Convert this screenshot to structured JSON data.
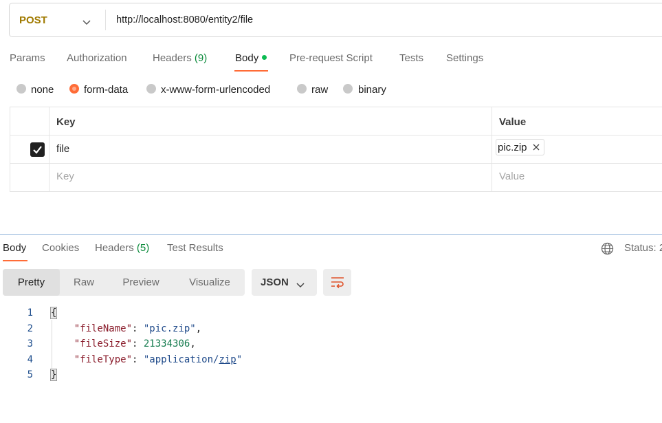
{
  "request": {
    "method": "POST",
    "url": "http://localhost:8080/entity2/file"
  },
  "request_tabs": {
    "params": "Params",
    "authorization": "Authorization",
    "headers": "Headers",
    "headers_count": "(9)",
    "body": "Body",
    "pre_request": "Pre-request Script",
    "tests": "Tests",
    "settings": "Settings"
  },
  "body_types": {
    "none": "none",
    "form_data": "form-data",
    "urlencoded": "x-www-form-urlencoded",
    "raw": "raw",
    "binary": "binary",
    "selected": "form-data"
  },
  "form_table": {
    "key_header": "Key",
    "value_header": "Value",
    "row1_key": "file",
    "row1_value": "pic.zip",
    "key_placeholder": "Key",
    "value_placeholder": "Value"
  },
  "response_tabs": {
    "body": "Body",
    "cookies": "Cookies",
    "headers": "Headers",
    "headers_count": "(5)",
    "test_results": "Test Results",
    "status": "Status: 2"
  },
  "view_modes": {
    "pretty": "Pretty",
    "raw": "Raw",
    "preview": "Preview",
    "visualize": "Visualize",
    "format": "JSON"
  },
  "code": {
    "line_numbers": [
      "1",
      "2",
      "3",
      "4",
      "5"
    ],
    "open_brace": "{",
    "close_brace": "}",
    "k1": "\"fileName\"",
    "v1": "\"pic.zip\"",
    "k2": "\"fileSize\"",
    "v2": "21334306",
    "k3": "\"fileType\"",
    "v3a": "\"application/",
    "v3b": "zip",
    "v3c": "\""
  },
  "colors": {
    "accent": "#ff6c37",
    "active_dot": "#0cbb52",
    "method": "#a07a00"
  }
}
